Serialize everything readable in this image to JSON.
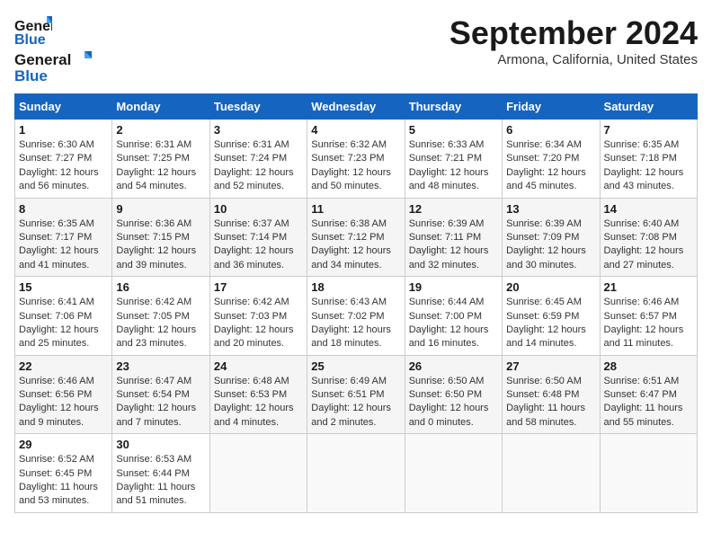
{
  "logo": {
    "line1": "General",
    "line2": "Blue"
  },
  "title": "September 2024",
  "subtitle": "Armona, California, United States",
  "days_of_week": [
    "Sunday",
    "Monday",
    "Tuesday",
    "Wednesday",
    "Thursday",
    "Friday",
    "Saturday"
  ],
  "weeks": [
    [
      {
        "day": "1",
        "content": "Sunrise: 6:30 AM\nSunset: 7:27 PM\nDaylight: 12 hours\nand 56 minutes."
      },
      {
        "day": "2",
        "content": "Sunrise: 6:31 AM\nSunset: 7:25 PM\nDaylight: 12 hours\nand 54 minutes."
      },
      {
        "day": "3",
        "content": "Sunrise: 6:31 AM\nSunset: 7:24 PM\nDaylight: 12 hours\nand 52 minutes."
      },
      {
        "day": "4",
        "content": "Sunrise: 6:32 AM\nSunset: 7:23 PM\nDaylight: 12 hours\nand 50 minutes."
      },
      {
        "day": "5",
        "content": "Sunrise: 6:33 AM\nSunset: 7:21 PM\nDaylight: 12 hours\nand 48 minutes."
      },
      {
        "day": "6",
        "content": "Sunrise: 6:34 AM\nSunset: 7:20 PM\nDaylight: 12 hours\nand 45 minutes."
      },
      {
        "day": "7",
        "content": "Sunrise: 6:35 AM\nSunset: 7:18 PM\nDaylight: 12 hours\nand 43 minutes."
      }
    ],
    [
      {
        "day": "8",
        "content": "Sunrise: 6:35 AM\nSunset: 7:17 PM\nDaylight: 12 hours\nand 41 minutes."
      },
      {
        "day": "9",
        "content": "Sunrise: 6:36 AM\nSunset: 7:15 PM\nDaylight: 12 hours\nand 39 minutes."
      },
      {
        "day": "10",
        "content": "Sunrise: 6:37 AM\nSunset: 7:14 PM\nDaylight: 12 hours\nand 36 minutes."
      },
      {
        "day": "11",
        "content": "Sunrise: 6:38 AM\nSunset: 7:12 PM\nDaylight: 12 hours\nand 34 minutes."
      },
      {
        "day": "12",
        "content": "Sunrise: 6:39 AM\nSunset: 7:11 PM\nDaylight: 12 hours\nand 32 minutes."
      },
      {
        "day": "13",
        "content": "Sunrise: 6:39 AM\nSunset: 7:09 PM\nDaylight: 12 hours\nand 30 minutes."
      },
      {
        "day": "14",
        "content": "Sunrise: 6:40 AM\nSunset: 7:08 PM\nDaylight: 12 hours\nand 27 minutes."
      }
    ],
    [
      {
        "day": "15",
        "content": "Sunrise: 6:41 AM\nSunset: 7:06 PM\nDaylight: 12 hours\nand 25 minutes."
      },
      {
        "day": "16",
        "content": "Sunrise: 6:42 AM\nSunset: 7:05 PM\nDaylight: 12 hours\nand 23 minutes."
      },
      {
        "day": "17",
        "content": "Sunrise: 6:42 AM\nSunset: 7:03 PM\nDaylight: 12 hours\nand 20 minutes."
      },
      {
        "day": "18",
        "content": "Sunrise: 6:43 AM\nSunset: 7:02 PM\nDaylight: 12 hours\nand 18 minutes."
      },
      {
        "day": "19",
        "content": "Sunrise: 6:44 AM\nSunset: 7:00 PM\nDaylight: 12 hours\nand 16 minutes."
      },
      {
        "day": "20",
        "content": "Sunrise: 6:45 AM\nSunset: 6:59 PM\nDaylight: 12 hours\nand 14 minutes."
      },
      {
        "day": "21",
        "content": "Sunrise: 6:46 AM\nSunset: 6:57 PM\nDaylight: 12 hours\nand 11 minutes."
      }
    ],
    [
      {
        "day": "22",
        "content": "Sunrise: 6:46 AM\nSunset: 6:56 PM\nDaylight: 12 hours\nand 9 minutes."
      },
      {
        "day": "23",
        "content": "Sunrise: 6:47 AM\nSunset: 6:54 PM\nDaylight: 12 hours\nand 7 minutes."
      },
      {
        "day": "24",
        "content": "Sunrise: 6:48 AM\nSunset: 6:53 PM\nDaylight: 12 hours\nand 4 minutes."
      },
      {
        "day": "25",
        "content": "Sunrise: 6:49 AM\nSunset: 6:51 PM\nDaylight: 12 hours\nand 2 minutes."
      },
      {
        "day": "26",
        "content": "Sunrise: 6:50 AM\nSunset: 6:50 PM\nDaylight: 12 hours\nand 0 minutes."
      },
      {
        "day": "27",
        "content": "Sunrise: 6:50 AM\nSunset: 6:48 PM\nDaylight: 11 hours\nand 58 minutes."
      },
      {
        "day": "28",
        "content": "Sunrise: 6:51 AM\nSunset: 6:47 PM\nDaylight: 11 hours\nand 55 minutes."
      }
    ],
    [
      {
        "day": "29",
        "content": "Sunrise: 6:52 AM\nSunset: 6:45 PM\nDaylight: 11 hours\nand 53 minutes."
      },
      {
        "day": "30",
        "content": "Sunrise: 6:53 AM\nSunset: 6:44 PM\nDaylight: 11 hours\nand 51 minutes."
      },
      {
        "day": "",
        "content": ""
      },
      {
        "day": "",
        "content": ""
      },
      {
        "day": "",
        "content": ""
      },
      {
        "day": "",
        "content": ""
      },
      {
        "day": "",
        "content": ""
      }
    ]
  ]
}
